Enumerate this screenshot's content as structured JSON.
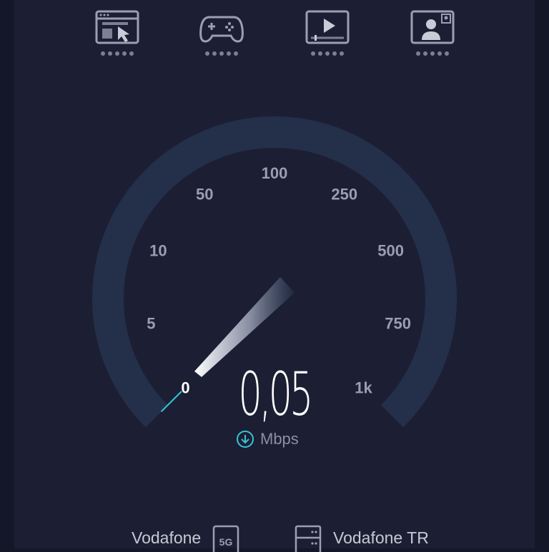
{
  "quality_indicators": [
    {
      "name": "web-browsing",
      "icon": "browser-cursor-icon"
    },
    {
      "name": "gaming",
      "icon": "gamepad-icon"
    },
    {
      "name": "video-streaming",
      "icon": "video-player-icon"
    },
    {
      "name": "video-calls",
      "icon": "video-call-icon"
    }
  ],
  "gauge": {
    "ticks": [
      "0",
      "5",
      "10",
      "50",
      "100",
      "250",
      "500",
      "750",
      "1k"
    ],
    "current_speed": "0,05",
    "speed_value": 0.05,
    "unit": "Mbps"
  },
  "footer": {
    "provider": "Vodafone",
    "network_badge": "5G",
    "server": "Vodafone TR"
  },
  "colors": {
    "background": "#1c1f33",
    "arc": "#24304a",
    "accent": "#36c4d6",
    "text_muted": "#8b8fa3"
  }
}
